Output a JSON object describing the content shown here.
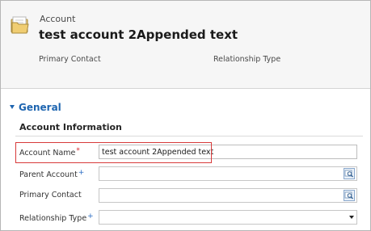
{
  "header": {
    "entity_type": "Account",
    "record_title": "test account 2Appended text",
    "fields": {
      "primary_contact": "Primary Contact",
      "relationship_type": "Relationship Type"
    }
  },
  "section": {
    "title": "General",
    "subsection_title": "Account Information"
  },
  "form": {
    "account_name": {
      "label": "Account Name",
      "required_marker": "*",
      "value": "test account 2Appended text"
    },
    "parent_account": {
      "label": "Parent Account",
      "recommended_marker": "+",
      "value": ""
    },
    "primary_contact": {
      "label": "Primary Contact",
      "value": ""
    },
    "relationship_type": {
      "label": "Relationship Type",
      "recommended_marker": "+",
      "value": ""
    }
  },
  "colors": {
    "section_accent": "#1e65b0",
    "required": "#d8262e",
    "recommended": "#2b6cc4",
    "highlight": "#d83a3a"
  },
  "icons": {
    "entity": "folder-icon",
    "lookup": "lookup-icon",
    "section_toggle": "caret-down-icon",
    "dropdown": "chevron-down-icon"
  }
}
